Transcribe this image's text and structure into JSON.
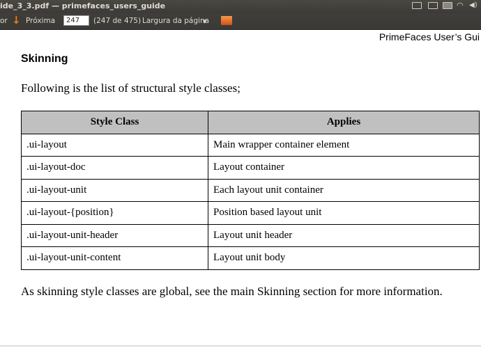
{
  "window": {
    "title": "ide_3_3.pdf — primefaces_users_guide"
  },
  "toolbar": {
    "prev_fragment": "or",
    "next_label": "Próxima",
    "page_value": "247",
    "page_count": "(247 de 475)",
    "zoom_label": "Largura da página"
  },
  "tray_icons": [
    "keyboard-icon",
    "mail-icon",
    "battery-icon",
    "wifi-icon",
    "volume-icon"
  ],
  "document": {
    "running_header": "PrimeFaces User’s Gui",
    "heading": "Skinning",
    "intro": "Following is the list of structural style classes;",
    "table": {
      "headers": [
        "Style Class",
        "Applies"
      ],
      "rows": [
        [
          ".ui-layout",
          "Main wrapper container element"
        ],
        [
          ".ui-layout-doc",
          "Layout container"
        ],
        [
          ".ui-layout-unit",
          "Each layout unit container"
        ],
        [
          ".ui-layout-{position}",
          "Position based layout unit"
        ],
        [
          ".ui-layout-unit-header",
          "Layout unit header"
        ],
        [
          ".ui-layout-unit-content",
          "Layout unit body"
        ]
      ]
    },
    "footer_text": "As skinning style classes are global, see the main Skinning section for more information."
  }
}
